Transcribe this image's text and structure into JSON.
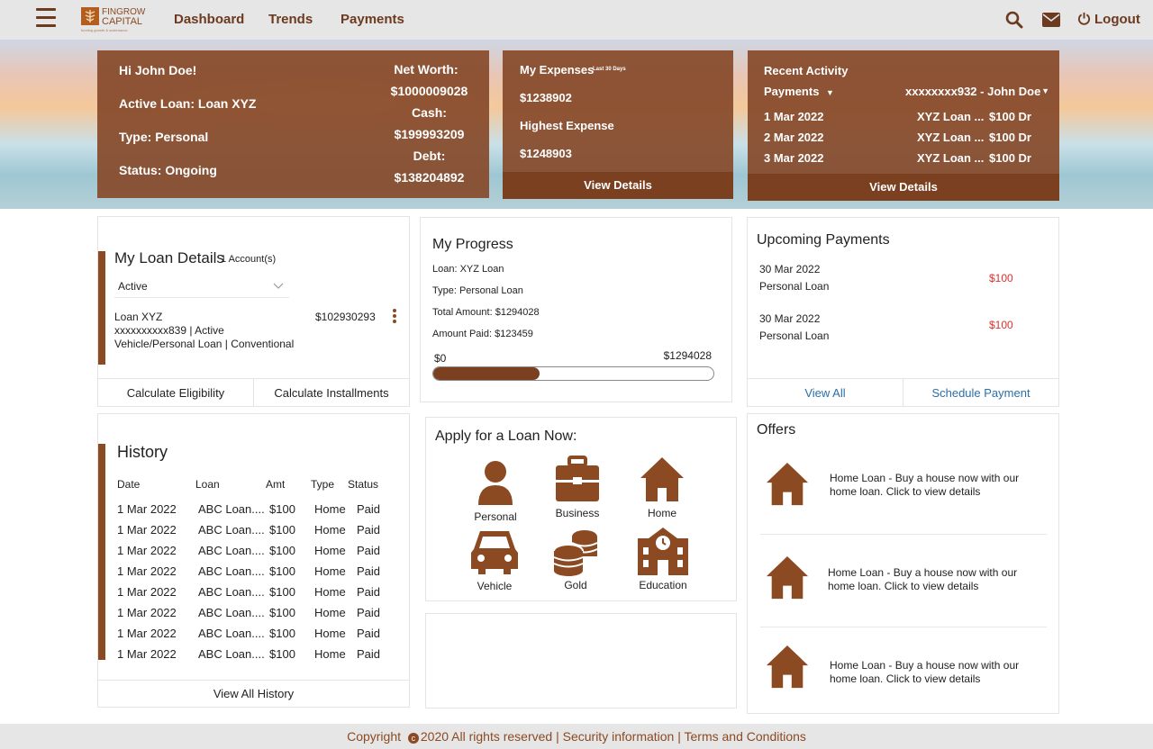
{
  "header": {
    "menu_icon": "hamburger-icon",
    "logo_line1": "FINGROW",
    "logo_line2": "CAPITAL",
    "logo_tagline": "funding growth & sustenance",
    "nav": [
      "Dashboard",
      "Trends",
      "Payments"
    ],
    "search_icon": "search-icon",
    "mail_icon": "mail-icon",
    "logout_label": "Logout"
  },
  "summary": {
    "greeting": "Hi John Doe!",
    "active_loan": "Active Loan: Loan XYZ",
    "type": "Type: Personal",
    "status": "Status: Ongoing",
    "net_worth_label": "Net Worth:",
    "net_worth": "$1000009028",
    "cash_label": "Cash:",
    "cash": "$199993209",
    "debt_label": "Debt:",
    "debt": "$138204892"
  },
  "expenses": {
    "title": "My Expenses",
    "period": "Last 30 Days",
    "total": "$1238902",
    "highest_label": "Highest Expense",
    "highest": "$1248903",
    "footer": "View Details"
  },
  "recent_activity": {
    "title": "Recent Activity",
    "filter": "Payments",
    "account": "xxxxxxxx932 - John Doe",
    "rows": [
      {
        "date": "1 Mar 2022",
        "desc": "XYZ Loan ...",
        "amt": "$100 Dr"
      },
      {
        "date": "2 Mar 2022",
        "desc": "XYZ Loan ...",
        "amt": "$100 Dr"
      },
      {
        "date": "3 Mar 2022",
        "desc": "XYZ Loan ...",
        "amt": "$100 Dr"
      }
    ],
    "footer": "View Details"
  },
  "loan_details": {
    "title": "My Loan Details",
    "count": "1 Account(s)",
    "filter": "Active",
    "loan_name": "Loan XYZ",
    "account_line": "xxxxxxxxxx839 | Active",
    "kind_line": "Vehicle/Personal Loan | Conventional",
    "amount": "$102930293",
    "btn_eligibility": "Calculate Eligibility",
    "btn_installments": "Calculate Installments"
  },
  "progress": {
    "title": "My Progress",
    "loan": "Loan: XYZ Loan",
    "type": "Type: Personal Loan",
    "total": "Total Amount: $1294028",
    "paid": "Amount Paid: $123459",
    "min_label": "$0",
    "max_label": "$1294028",
    "fraction": 0.38
  },
  "upcoming": {
    "title": "Upcoming Payments",
    "items": [
      {
        "date": "30 Mar 2022",
        "name": "Personal Loan",
        "amount": "$100"
      },
      {
        "date": "30 Mar 2022",
        "name": "Personal Loan",
        "amount": "$100"
      }
    ],
    "view_all": "View All",
    "schedule": "Schedule Payment"
  },
  "history": {
    "title": "History",
    "columns": [
      "Date",
      "Loan",
      "Amt",
      "Type",
      "Status"
    ],
    "rows": [
      [
        "1 Mar 2022",
        "ABC Loan....",
        "$100",
        "Home",
        "Paid"
      ],
      [
        "1 Mar 2022",
        "ABC Loan....",
        "$100",
        "Home",
        "Paid"
      ],
      [
        "1 Mar 2022",
        "ABC Loan....",
        "$100",
        "Home",
        "Paid"
      ],
      [
        "1 Mar 2022",
        "ABC Loan....",
        "$100",
        "Home",
        "Paid"
      ],
      [
        "1 Mar 2022",
        "ABC Loan....",
        "$100",
        "Home",
        "Paid"
      ],
      [
        "1 Mar 2022",
        "ABC Loan....",
        "$100",
        "Home",
        "Paid"
      ],
      [
        "1 Mar 2022",
        "ABC Loan....",
        "$100",
        "Home",
        "Paid"
      ],
      [
        "1 Mar 2022",
        "ABC Loan....",
        "$100",
        "Home",
        "Paid"
      ]
    ],
    "footer": "View All History"
  },
  "apply": {
    "title": "Apply for a Loan Now:",
    "tiles": [
      {
        "label": "Personal",
        "icon": "person-icon"
      },
      {
        "label": "Business",
        "icon": "briefcase-icon"
      },
      {
        "label": "Home",
        "icon": "house-icon"
      },
      {
        "label": "Vehicle",
        "icon": "car-icon"
      },
      {
        "label": "Gold",
        "icon": "coins-icon"
      },
      {
        "label": "Education",
        "icon": "school-icon"
      }
    ]
  },
  "offers": {
    "title": "Offers",
    "items": [
      {
        "text": "Home Loan - Buy a house  now with our home loan. Click to view details",
        "icon": "house-icon"
      },
      {
        "text": "Home Loan - Buy a house  now with our home loan. Click to view details",
        "icon": "house-icon"
      },
      {
        "text": "Home Loan - Buy a house  now with our home loan. Click to view details",
        "icon": "house-icon"
      }
    ]
  },
  "footer": {
    "copyright": "Copyright",
    "year_text": "2020 All rights reserved",
    "security": "Security information",
    "terms": "Terms and Conditions"
  },
  "colors": {
    "brand": "#8b4a22",
    "link": "#2b6ea8",
    "due": "#e0302a"
  }
}
